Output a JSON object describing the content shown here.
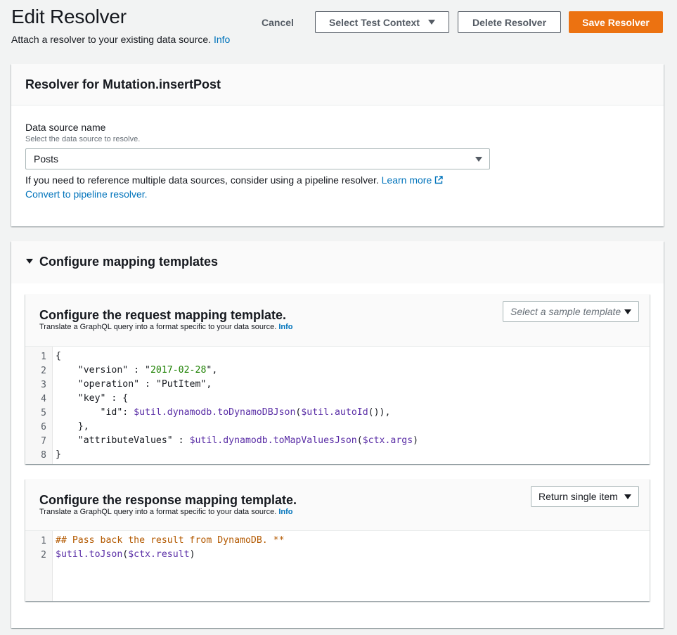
{
  "header": {
    "title": "Edit Resolver",
    "subtitle": "Attach a resolver to your existing data source.",
    "info_link": "Info",
    "cancel_label": "Cancel",
    "test_context_label": "Select Test Context",
    "delete_label": "Delete Resolver",
    "save_label": "Save Resolver"
  },
  "resolver_panel": {
    "title": "Resolver for Mutation.insertPost",
    "data_source_label": "Data source name",
    "data_source_desc": "Select the data source to resolve.",
    "data_source_value": "Posts",
    "pipeline_text": "If you need to reference multiple data sources, consider using a pipeline resolver.",
    "learn_more": "Learn more",
    "convert_link": "Convert to pipeline resolver."
  },
  "mapping_panel": {
    "title": "Configure mapping templates",
    "request": {
      "title": "Configure the request mapping template.",
      "desc": "Translate a GraphQL query into a format specific to your data source.",
      "info": "Info",
      "select_placeholder": "Select a sample template",
      "lines": [
        {
          "n": "1",
          "code": "{"
        },
        {
          "n": "2",
          "code": "    \"version\" : \"2017-02-28\","
        },
        {
          "n": "3",
          "code": "    \"operation\" : \"PutItem\","
        },
        {
          "n": "4",
          "code": "    \"key\" : {"
        },
        {
          "n": "5",
          "code": "        \"id\": $util.dynamodb.toDynamoDBJson($util.autoId()),"
        },
        {
          "n": "6",
          "code": "    },"
        },
        {
          "n": "7",
          "code": "    \"attributeValues\" : $util.dynamodb.toMapValuesJson($ctx.args)"
        },
        {
          "n": "8",
          "code": "}"
        }
      ]
    },
    "response": {
      "title": "Configure the response mapping template.",
      "desc": "Translate a GraphQL query into a format specific to your data source.",
      "info": "Info",
      "select_value": "Return single item",
      "lines": [
        {
          "n": "1",
          "code": "## Pass back the result from DynamoDB. **"
        },
        {
          "n": "2",
          "code": "$util.toJson($ctx.result)"
        }
      ]
    }
  },
  "colors": {
    "primary": "#ec7211",
    "link": "#0073bb",
    "variable": "#5a2ea6",
    "comment": "#b35900"
  }
}
